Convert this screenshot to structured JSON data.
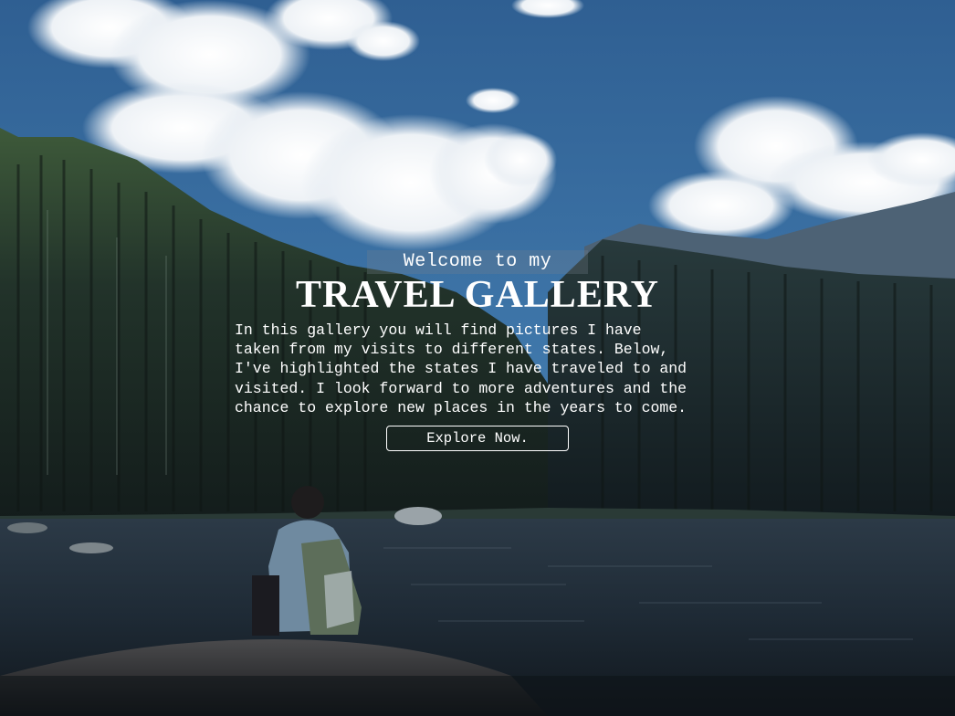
{
  "hero": {
    "welcome": "Welcome to my",
    "title": "TRAVEL GALLERY",
    "intro_lines": [
      "In this gallery you will find pictures I have",
      "taken from my visits to different states. Below,",
      "I've highlighted the states I have traveled to and",
      "visited. I look forward to more adventures and the",
      "chance to explore new places in the years to come."
    ],
    "button_label": "Explore Now."
  },
  "colors": {
    "sky": "#3a6ea0",
    "text": "#ffffff",
    "forest": "#1c2a2a",
    "water": "#1d2a36"
  }
}
